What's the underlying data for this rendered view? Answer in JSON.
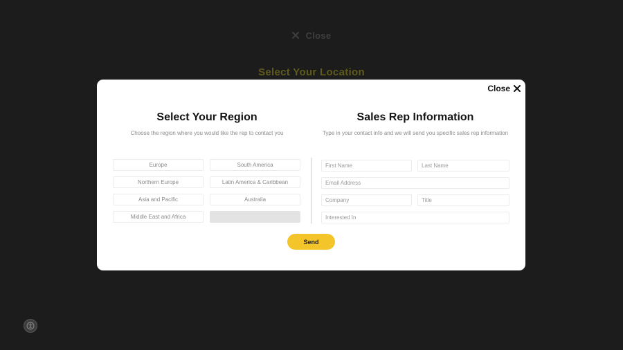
{
  "background": {
    "close_label": "Close",
    "title": "Select Your Location"
  },
  "modal": {
    "close_label": "Close",
    "region": {
      "title": "Select Your Region",
      "subtitle": "Choose the region where you would like the rep to contact you",
      "options": [
        "Europe",
        "South America",
        "Northern Europe",
        "Latin America & Caribbean",
        "Asia and Pacific",
        "Australia",
        "Middle East and Africa",
        ""
      ]
    },
    "sales": {
      "title": "Sales Rep Information",
      "subtitle": "Type in your contact info and we will send you specific sales rep information",
      "fields": {
        "first_name": "First Name",
        "last_name": "Last Name",
        "email": "Email Address",
        "company": "Company",
        "title": "Title",
        "interested_in": "Interested In"
      }
    },
    "send_label": "Send"
  },
  "colors": {
    "accent": "#f4c52b",
    "overlay": "#1c1c1c",
    "muted_title": "#5f5a1c"
  },
  "icons": [
    "close-icon",
    "accessibility-icon"
  ]
}
